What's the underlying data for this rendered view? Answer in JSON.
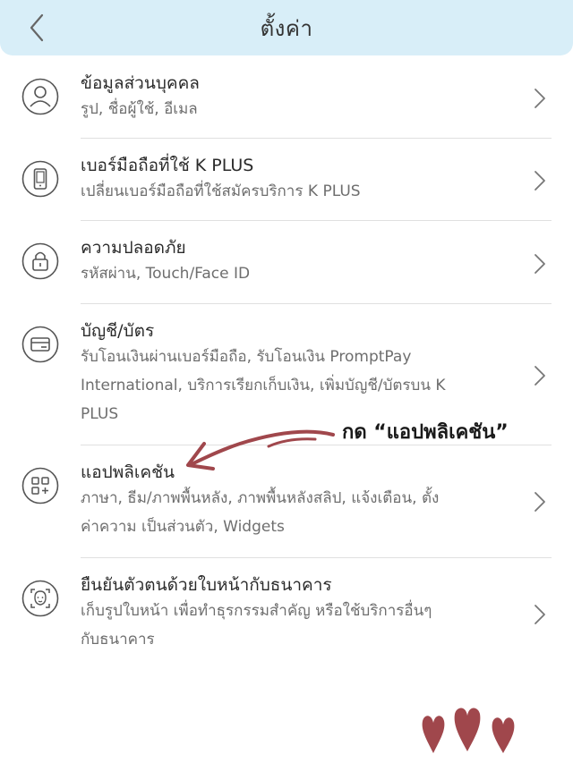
{
  "header": {
    "title": "ตั้งค่า",
    "back_icon": "chevron-left-icon"
  },
  "menu": {
    "items": [
      {
        "icon": "person-icon",
        "label": "ข้อมูลส่วนบุคคล",
        "sub": [
          "รูป, ชื่อผู้ใช้, อีเมล"
        ]
      },
      {
        "icon": "mobile-phone-icon",
        "label": "เบอร์มือถือที่ใช้ K PLUS",
        "sub": [
          "เปลี่ยนเบอร์มือถือที่ใช้สมัครบริการ K PLUS"
        ]
      },
      {
        "icon": "lock-icon",
        "label": "ความปลอดภัย",
        "sub": [
          "รหัสผ่าน, Touch/Face ID"
        ]
      },
      {
        "icon": "card-icon",
        "label": "บัญชี/บัตร",
        "sub": [
          "รับโอนเงินผ่านเบอร์มือถือ, รับโอนเงิน PromptPay",
          "International, บริการเรียกเก็บเงิน, เพิ่มบัญชี/บัตรบน K",
          "PLUS"
        ]
      },
      {
        "icon": "apps-grid-icon",
        "label": "แอปพลิเคชัน",
        "sub": [
          "ภาษา, ธีม/ภาพพื้นหลัง, ภาพพื้นหลังสลิป, แจ้งเตือน, ตั้ง",
          "ค่าความ เป็นส่วนตัว, Widgets"
        ]
      },
      {
        "icon": "face-scan-icon",
        "label": "ยืนยันตัวตนด้วยใบหน้ากับธนาคาร",
        "sub": [
          "เก็บรูปใบหน้า เพื่อทำธุรกรรมสำคัญ หรือใช้บริการอื่นๆ",
          "กับธนาคาร"
        ]
      }
    ]
  },
  "annotation": {
    "text": "กด “แอปพลิเคชัน”",
    "arrow_color": "#a0474c",
    "hearts_color": "#a0474c"
  },
  "colors": {
    "header_bg": "#d8eef8",
    "icon_stroke": "#555555",
    "divider": "#e0e0e0"
  }
}
